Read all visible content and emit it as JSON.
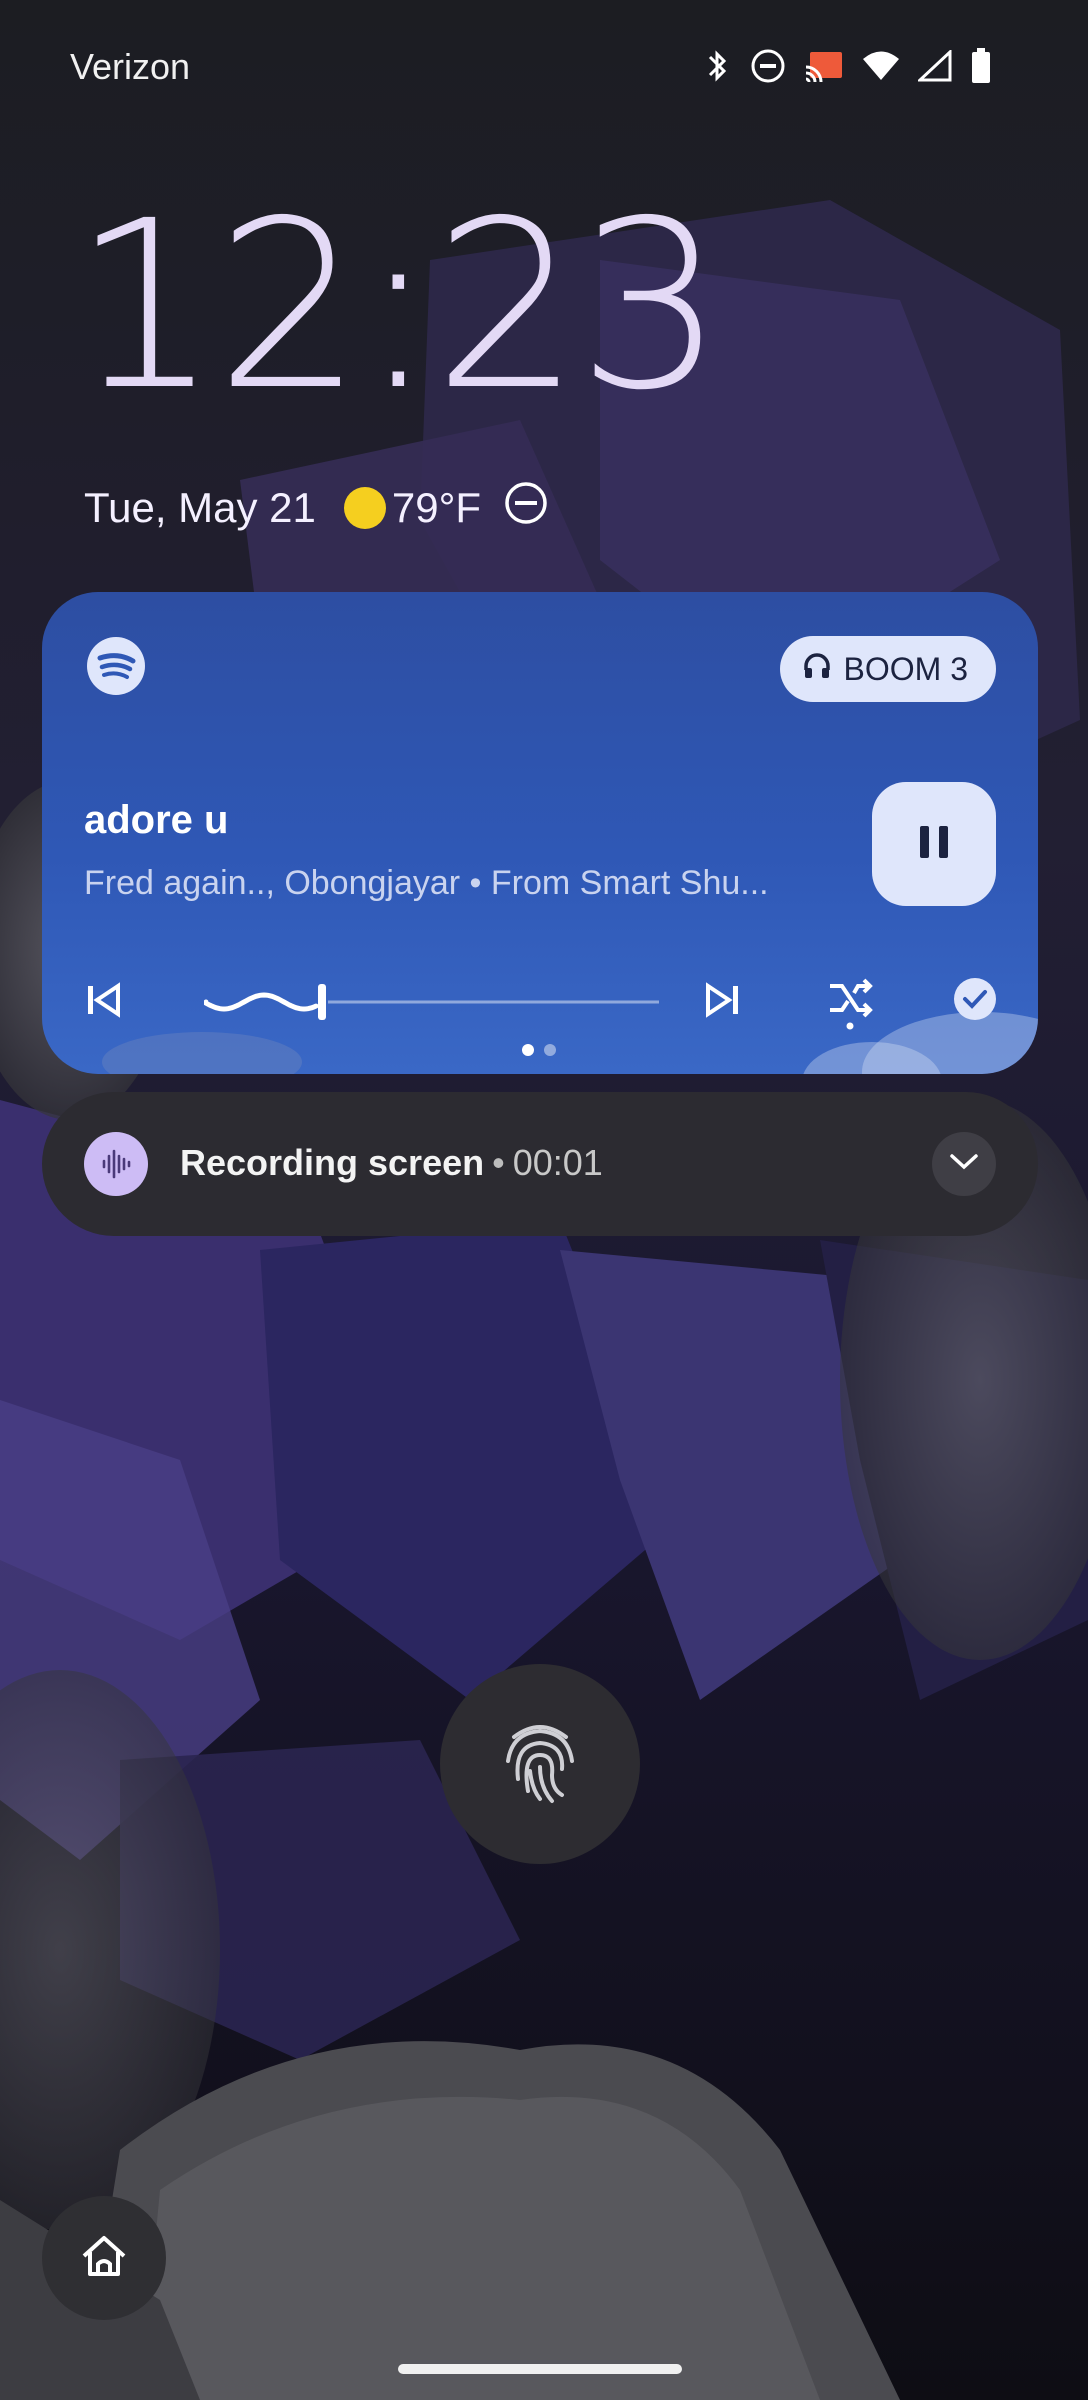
{
  "status_bar": {
    "carrier": "Verizon",
    "icons": [
      "bluetooth-icon",
      "dnd-icon",
      "cast-icon",
      "wifi-icon",
      "signal-icon",
      "battery-icon"
    ]
  },
  "lockscreen": {
    "time": "12:23",
    "date": "Tue, May 21",
    "temperature": "79°F",
    "weather_icon": "sunny-icon",
    "dnd_icon": "dnd-icon"
  },
  "media": {
    "app_icon": "spotify-icon",
    "output_device": "BOOM 3",
    "output_icon": "headphones-icon",
    "title": "adore u",
    "artist": "Fred again.., Obongjayar • From Smart Shu...",
    "progress": 0.26,
    "accent": "#2f58b6",
    "page_count": 2,
    "current_page": 1
  },
  "recording": {
    "title": "Recording screen",
    "separator": "•",
    "elapsed": "00:01",
    "icon": "audio-wave-icon",
    "icon_color": "#cdbcf5"
  },
  "bottom": {
    "fingerprint_icon": "fingerprint-icon",
    "home_icon": "home-icon"
  }
}
